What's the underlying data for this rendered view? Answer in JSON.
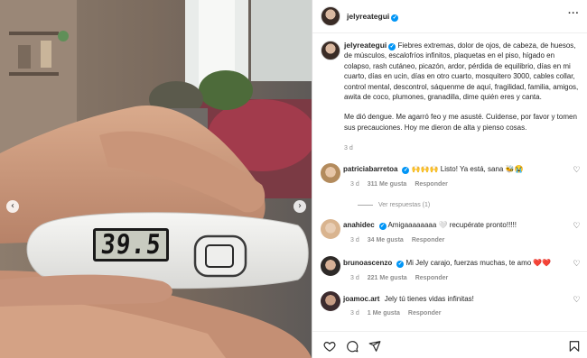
{
  "post": {
    "author": "jelyreategui",
    "thermometer_reading": "39.5",
    "caption": "Fiebres extremas, dolor de ojos, de cabeza, de huesos, de músculos, escalofríos infinitos, plaquetas en el piso, hígado en colapso, rash cutáneo, picazón, ardor, pérdida de equilibrio, días en mi cuarto, días en ucin, días en otro cuarto, mosquitero 3000, cables collar, control mental, descontrol, sáquenme de aquí, fragilidad, familia, amigos, awita de coco, plumones, granadilla, dime quién eres y canta.",
    "caption_2": "Me dió dengue. Me agarró feo y me asusté. Cuídense, por favor y tomen sus precauciones. Hoy me dieron de alta y pienso cosas.",
    "time": "3 d"
  },
  "comments": [
    {
      "user": "patriciabarretoa",
      "verified": true,
      "text": "🙌🙌🙌 Listo! Ya está, sana 🐝😭",
      "time": "3 d",
      "likes": "311 Me gusta",
      "reply": "Responder",
      "view_replies": "Ver respuestas (1)"
    },
    {
      "user": "anahidec",
      "verified": true,
      "text": "Amigaaaaaaaa 🤍 recupérate pronto!!!!!",
      "time": "3 d",
      "likes": "34 Me gusta",
      "reply": "Responder"
    },
    {
      "user": "brunoascenzo",
      "verified": true,
      "text": "Mi Jely carajo, fuerzas muchas, te amo ❤️❤️",
      "time": "3 d",
      "likes": "221 Me gusta",
      "reply": "Responder"
    },
    {
      "user": "joamoc.art",
      "verified": false,
      "text": "Jely tú tienes vidas infinitas!",
      "time": "3 d",
      "likes": "1 Me gusta",
      "reply": "Responder"
    }
  ],
  "icons": {
    "more": "more-options-icon",
    "verified": "verified-badge-icon",
    "heart": "heart-icon",
    "comment": "comment-icon",
    "share": "share-icon",
    "save": "bookmark-icon",
    "prev": "chevron-left-icon",
    "next": "chevron-right-icon"
  },
  "colors": {
    "verified": "#0095f6",
    "text": "#262626",
    "secondary": "#8e8e8e"
  }
}
